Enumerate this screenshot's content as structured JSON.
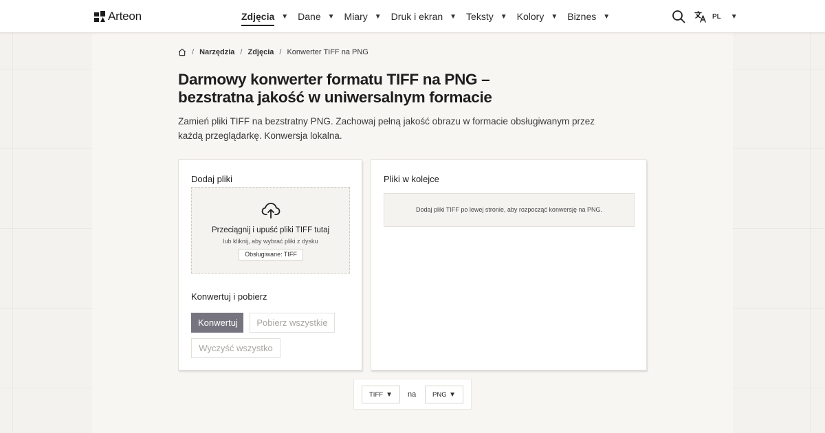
{
  "header": {
    "brand": "Arteon",
    "nav": [
      {
        "label": "Zdjęcia",
        "active": true
      },
      {
        "label": "Dane",
        "active": false
      },
      {
        "label": "Miary",
        "active": false
      },
      {
        "label": "Druk i ekran",
        "active": false
      },
      {
        "label": "Teksty",
        "active": false
      },
      {
        "label": "Kolory",
        "active": false
      },
      {
        "label": "Biznes",
        "active": false
      }
    ],
    "caret": "▼",
    "search_icon": "search-icon",
    "language": {
      "icon": "translate-icon",
      "code": "PL"
    }
  },
  "breadcrumb": {
    "home_icon": "home-icon",
    "separator": "/",
    "items": [
      "Narzędzia",
      "Zdjęcia",
      "Konwerter TIFF na PNG"
    ]
  },
  "page": {
    "title": "Darmowy konwerter formatu TIFF na PNG – bezstratna jakość w uniwersalnym formacie",
    "description": "Zamień pliki TIFF na bezstratny PNG. Zachowaj pełną jakość obrazu w formacie obsługiwanym przez każdą przeglądarkę. Konwersja lokalna."
  },
  "upload": {
    "title": "Dodaj pliki",
    "icon": "cloud-upload-icon",
    "drop_main": "Przeciągnij i upuść pliki TIFF tutaj",
    "drop_sub": "lub kliknij, aby wybrać pliki z dysku",
    "supported": "Obsługiwane: TIFF"
  },
  "convert": {
    "title": "Konwertuj i pobierz",
    "convert_label": "Konwertuj",
    "download_all_label": "Pobierz wszystkie",
    "clear_all_label": "Wyczyść wszystko"
  },
  "queue": {
    "title": "Pliki w kolejce",
    "empty_message": "Dodaj pliki TIFF po lewej stronie, aby rozpocząć konwersję na PNG."
  },
  "format": {
    "from": "TIFF",
    "separator": "na",
    "to": "PNG"
  },
  "colors": {
    "primary_button": "#76757f",
    "background": "#f4f2ee"
  }
}
